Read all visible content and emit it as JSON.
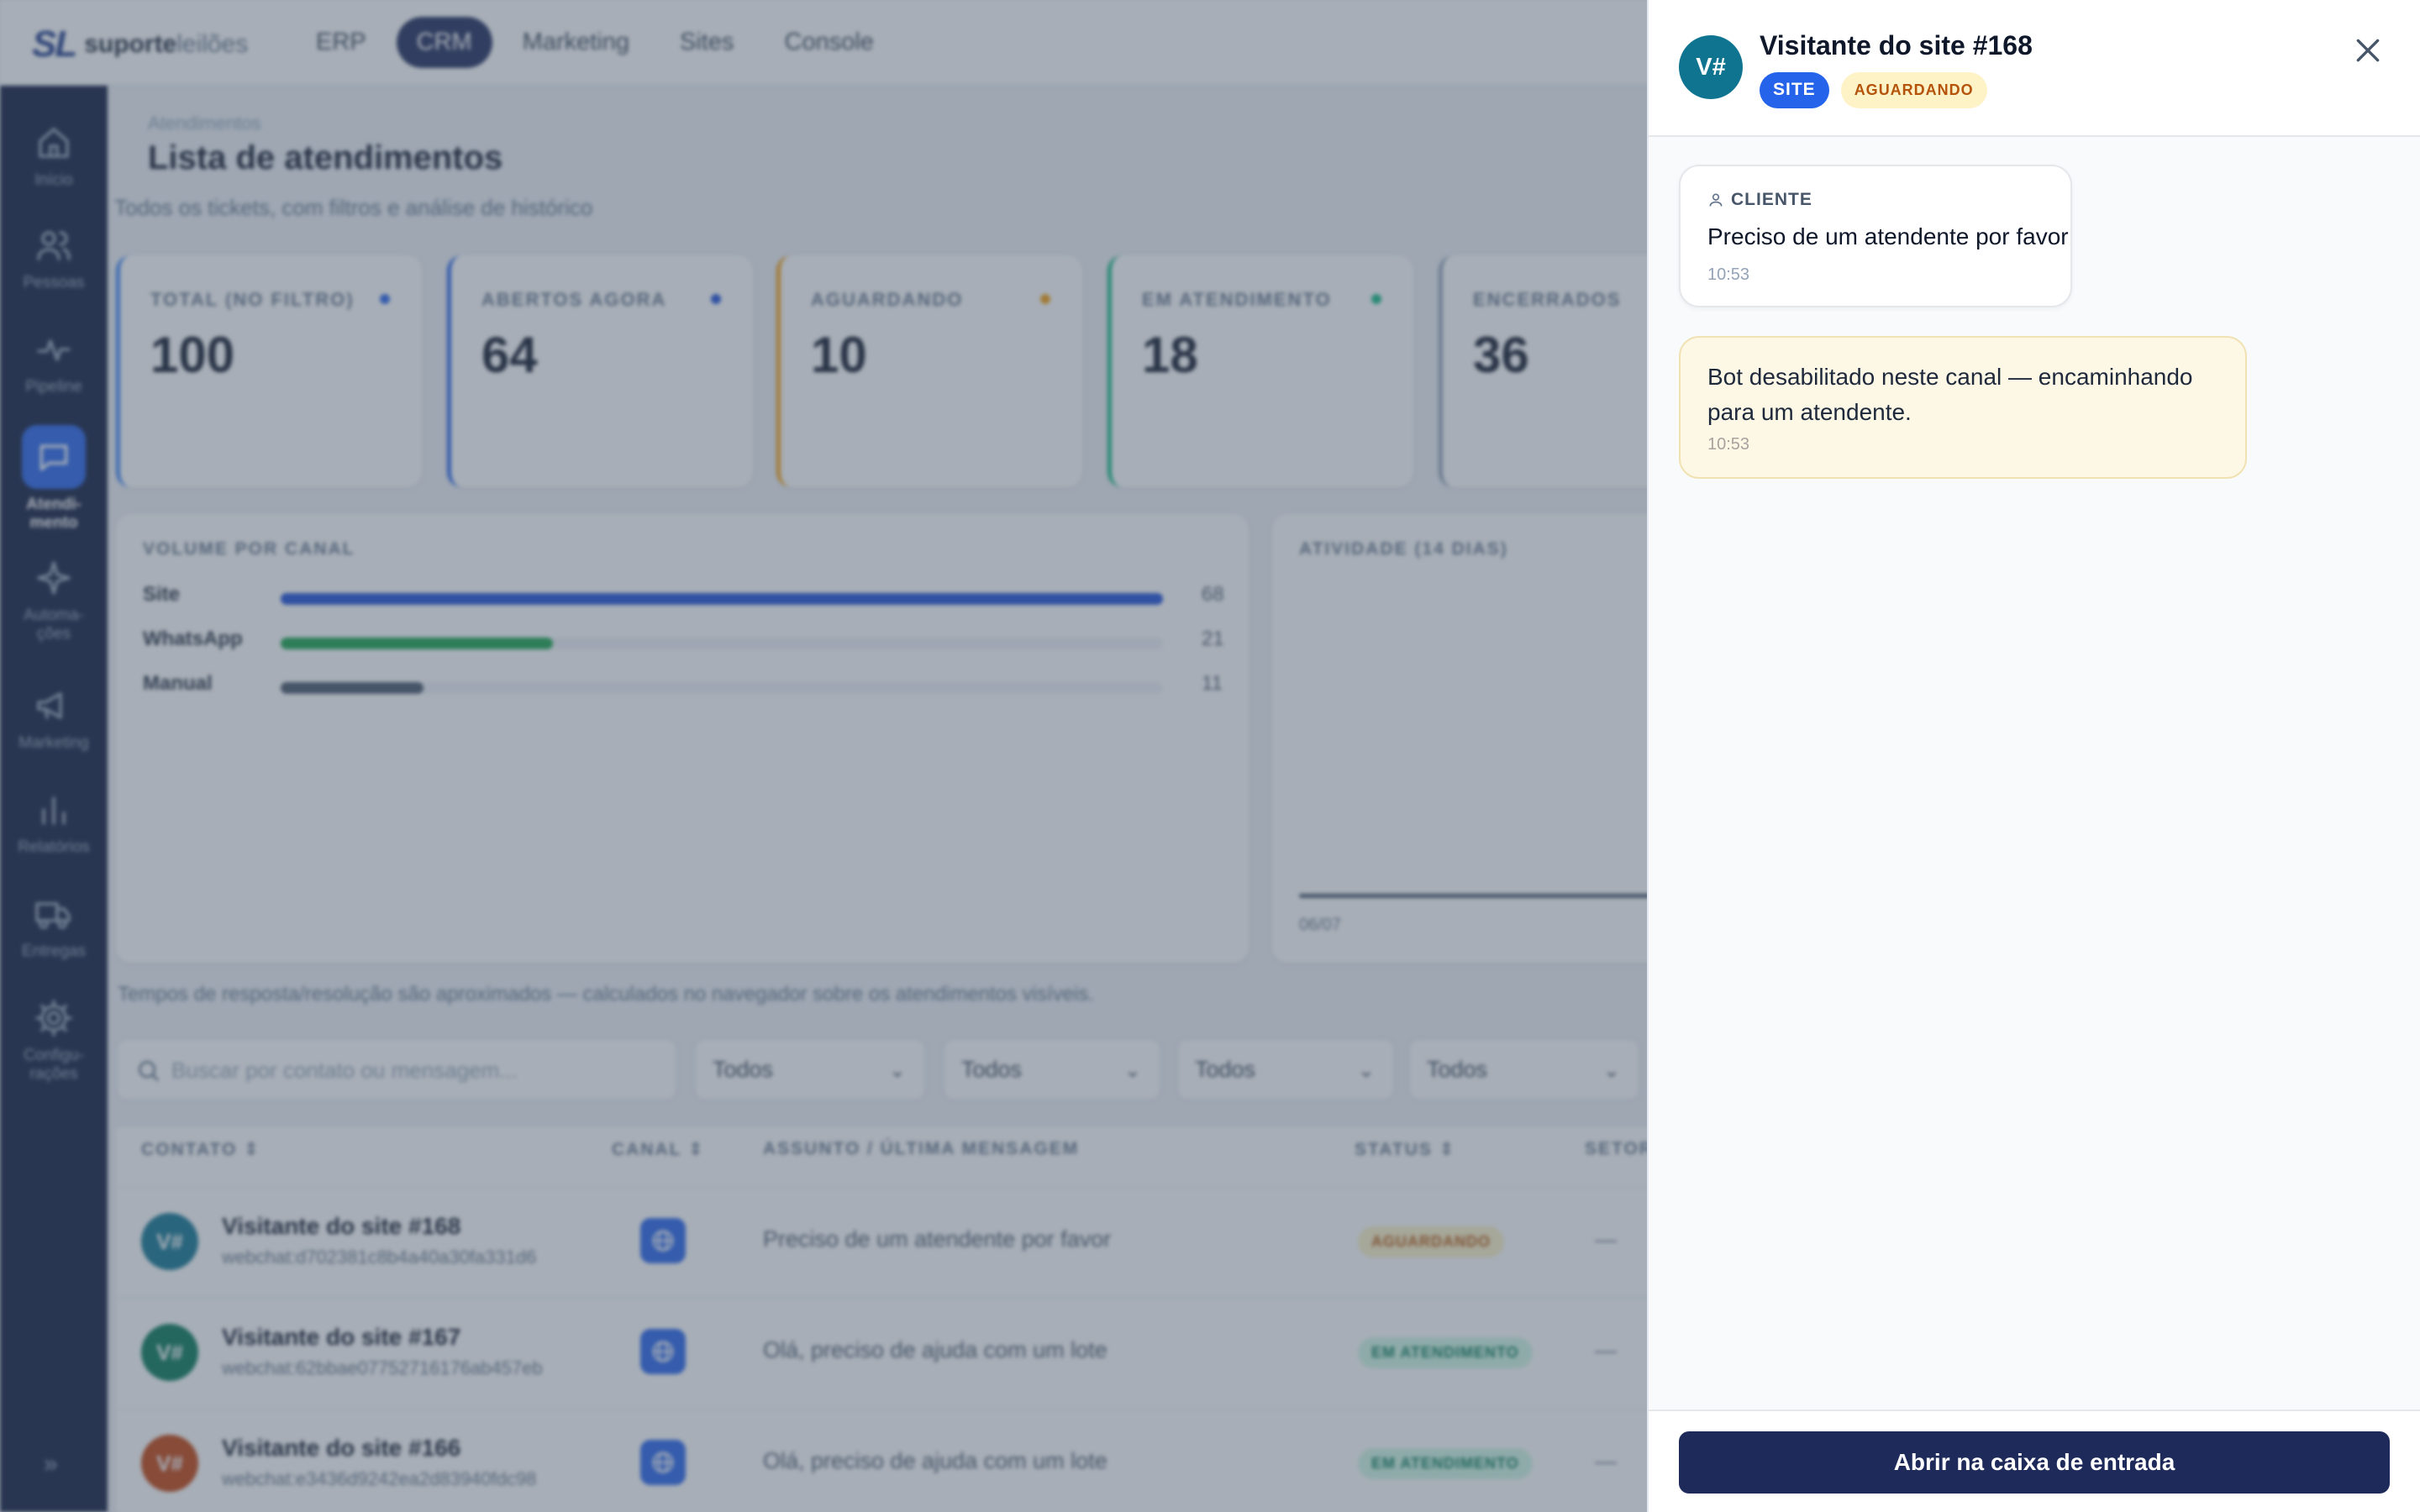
{
  "brand": {
    "mark": "SL",
    "name_bold": "suporte",
    "name_light": "leilões"
  },
  "topnav": [
    {
      "label": "ERP"
    },
    {
      "label": "CRM"
    },
    {
      "label": "Marketing"
    },
    {
      "label": "Sites"
    },
    {
      "label": "Console"
    }
  ],
  "topnav_active": "CRM",
  "sidebar": [
    {
      "label": "Início",
      "icon": "home-icon"
    },
    {
      "label": "Pessoas",
      "icon": "people-icon"
    },
    {
      "label": "Pipeline",
      "icon": "pulse-icon"
    },
    {
      "label": "Atendi-\nmento",
      "icon": "chat-icon",
      "active": true
    },
    {
      "label": "Automa-\nções",
      "icon": "sparkle-icon"
    },
    {
      "label": "Marketing",
      "icon": "megaphone-icon"
    },
    {
      "label": "Relatórios",
      "icon": "bar-chart-icon"
    },
    {
      "label": "Entregas",
      "icon": "truck-icon"
    },
    {
      "label": "Configu-\nrações",
      "icon": "gear-icon"
    }
  ],
  "sidebar_expand": "»",
  "page": {
    "breadcrumb": "Atendimentos",
    "title": "Lista de atendimentos",
    "subtitle": "Todos os tickets, com filtros e análise de histórico"
  },
  "kpis": [
    {
      "label": "TOTAL (NO FILTRO)",
      "value": "100",
      "color": "#3b82f6",
      "dot": "#2563eb"
    },
    {
      "label": "ABERTOS AGORA",
      "value": "64",
      "color": "#2563eb",
      "dot": "#1d4ed8"
    },
    {
      "label": "AGUARDANDO",
      "value": "10",
      "color": "#f59e0b",
      "dot": "#f59e0b"
    },
    {
      "label": "EM ATENDIMENTO",
      "value": "18",
      "color": "#10b981",
      "dot": "#10b981"
    },
    {
      "label": "ENCERRADOS",
      "value": "36",
      "color": "#94a3b8",
      "dot": "#94a3b8"
    }
  ],
  "volume": {
    "title": "VOLUME POR CANAL",
    "channels": [
      {
        "name": "Site",
        "value": 68,
        "color": "#1d4ed8"
      },
      {
        "name": "WhatsApp",
        "value": 21,
        "color": "#16a34a"
      },
      {
        "name": "Manual",
        "value": 11,
        "color": "#475569"
      }
    ],
    "max": 68
  },
  "activity": {
    "title": "ATIVIDADE (14 DIAS)",
    "first_tick": "06/07"
  },
  "note": "Tempos de resposta/resolução são aproximados — calculados no navegador sobre os atendimentos visíveis.",
  "filters": {
    "search_placeholder": "Buscar por contato ou mensagem...",
    "selects": [
      "Todos",
      "Todos",
      "Todos",
      "Todos"
    ]
  },
  "table": {
    "headers": [
      "CONTATO",
      "CANAL",
      "ASSUNTO / ÚLTIMA MENSAGEM",
      "STATUS",
      "SETOR"
    ],
    "rows": [
      {
        "initials": "V#",
        "name": "Visitante do site #168",
        "id": "webchat:d702381c8b4a40a30fa331d6",
        "message": "Preciso de um atendente por favor",
        "status": "AGUARDANDO",
        "sector": "—",
        "avatar_color": "#0e7490",
        "status_bg": "#fef3c7",
        "status_fg": "#b45309"
      },
      {
        "initials": "V#",
        "name": "Visitante do site #167",
        "id": "webchat:62bbae07752716176ab457eb",
        "message": "Olá, preciso de ajuda com um lote",
        "status": "EM ATENDIMENTO",
        "sector": "—",
        "avatar_color": "#047857",
        "status_bg": "#d1fae5",
        "status_fg": "#047857"
      },
      {
        "initials": "V#",
        "name": "Visitante do site #166",
        "id": "webchat:e3436d9242ea2d83940fdc98",
        "message": "Olá, preciso de ajuda com um lote",
        "status": "EM ATENDIMENTO",
        "sector": "—",
        "avatar_color": "#c2410c",
        "status_bg": "#d1fae5",
        "status_fg": "#047857"
      }
    ]
  },
  "drawer": {
    "avatar": "V#",
    "title": "Visitante do site #168",
    "badge_channel": "SITE",
    "badge_status": "AGUARDANDO",
    "messages": [
      {
        "from": "CLIENTE",
        "text": "Preciso de um atendente por favor",
        "time": "10:53"
      },
      {
        "from": "bot",
        "text": "Bot desabilitado neste canal — encaminhando para um atendente.",
        "time": "10:53"
      }
    ],
    "open_inbox_label": "Abrir na caixa de entrada"
  }
}
